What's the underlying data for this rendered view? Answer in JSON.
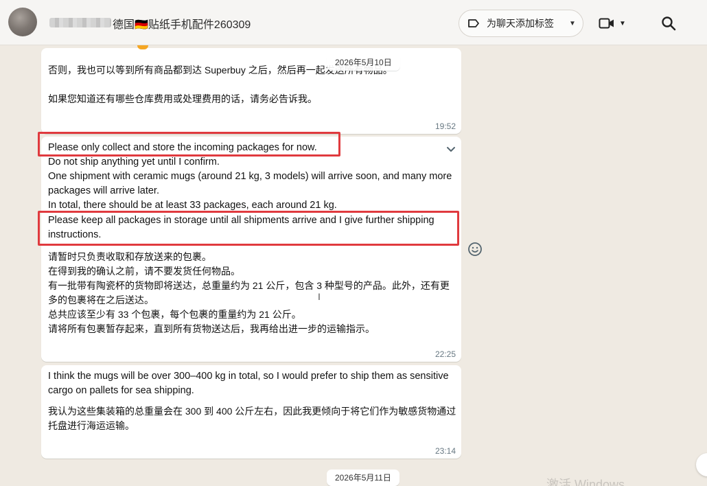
{
  "header": {
    "contact_name": "德国🇩🇪贴纸手机配件260309",
    "label_button": "为聊天添加标签"
  },
  "dates": {
    "top": "2026年5月10日",
    "bottom": "2026年5月11日"
  },
  "messages": [
    {
      "text": "否则，我也可以等到所有商品都到达 Superbuy 之后，然后再一起发送所有物品。\n\n如果您知道还有哪些仓库费用或处理费用的话，请务必告诉我。",
      "time": "19:52"
    },
    {
      "en_highlight_1": "Please only collect and store the incoming packages for now.",
      "en_body": "Do not ship anything yet until I confirm.\nOne shipment with ceramic mugs (around 21 kg, 3 models) will arrive soon, and many more packages will arrive later.\nIn total, there should be at least 33 packages, each around 21 kg.",
      "en_highlight_2": "Please keep all packages in storage until all shipments arrive and I give further shipping instructions.",
      "zh_body": "请暂时只负责收取和存放送来的包裹。\n在得到我的确认之前，请不要发货任何物品。\n有一批带有陶瓷杯的货物即将送达，总重量约为 21 公斤，包含 3 种型号的产品。此外，还有更多的包裹将在之后送达。\n总共应该至少有 33 个包裹，每个包裹的重量约为 21 公斤。\n请将所有包裹暂存起来，直到所有货物送达后，我再给出进一步的运输指示。",
      "time": "22:25"
    },
    {
      "en_body": "I think the mugs will be over 300–400 kg in total, so I would prefer to ship them as sensitive cargo on pallets for sea shipping.",
      "zh_body": "我认为这些集装箱的总重量会在 300 到 400 公斤左右，因此我更倾向于将它们作为敏感货物通过托盘进行海运运输。",
      "time": "23:14"
    }
  ],
  "watermark": "激活 Windows",
  "icons": [
    "label-icon",
    "video-call-icon",
    "search-icon",
    "chevron-down-icon",
    "emoji-react-icon",
    "scroll-down-icon"
  ]
}
